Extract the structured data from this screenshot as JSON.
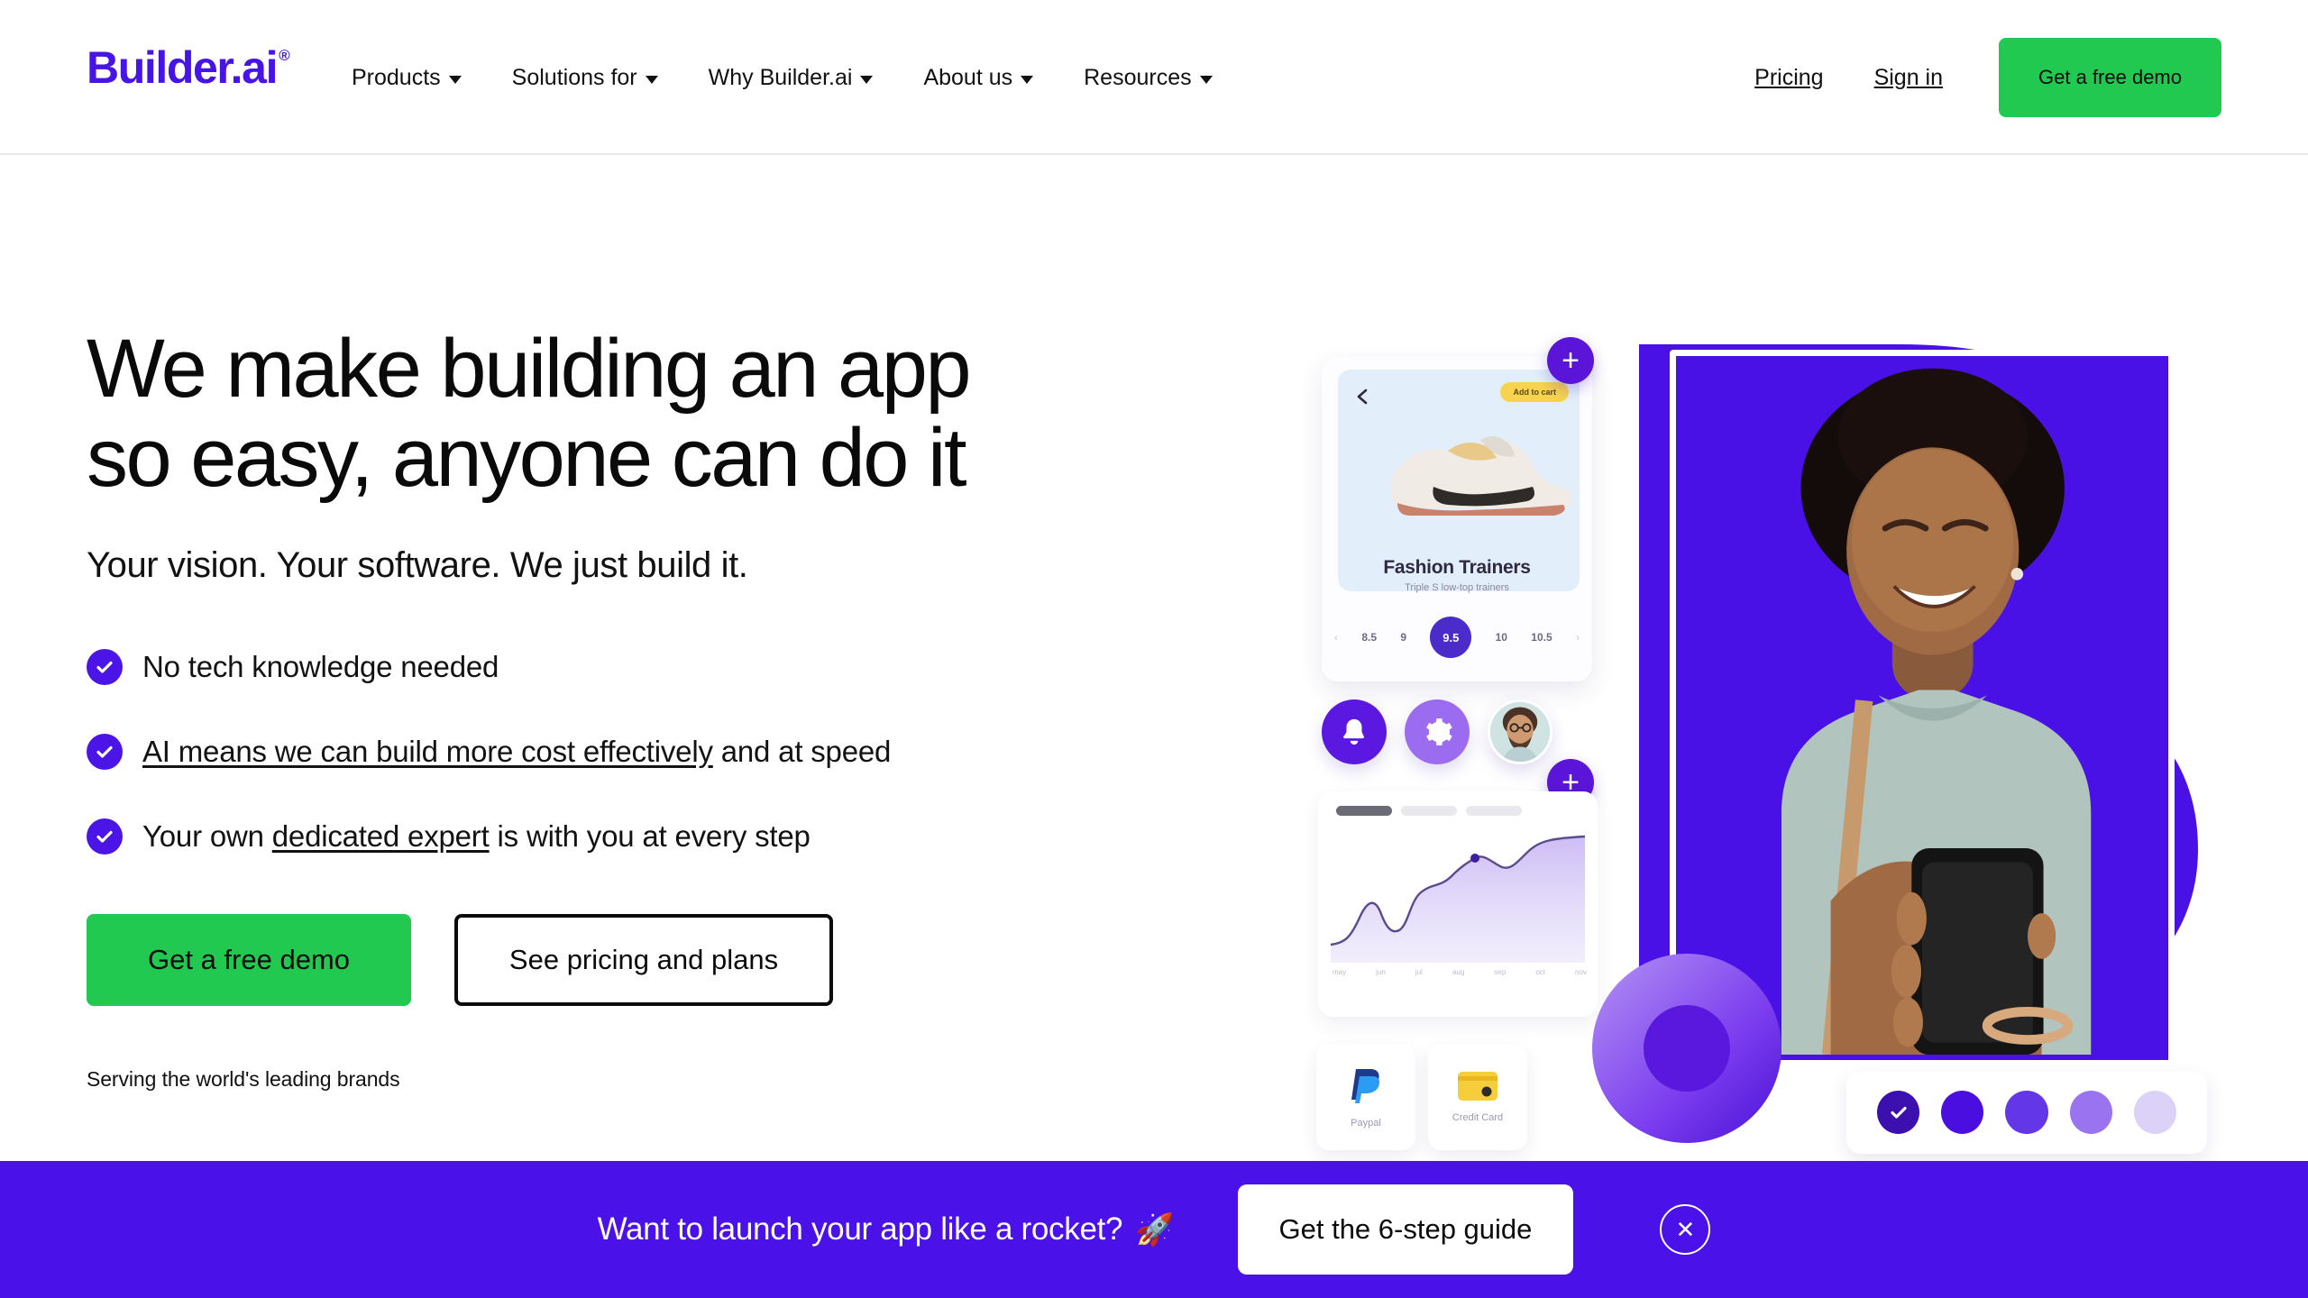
{
  "brand": {
    "logo_text": "Builder.ai",
    "logo_trademark": "®",
    "accent_purple": "#4614E6",
    "accent_green": "#22C950",
    "banner_purple": "#4A11E8"
  },
  "header": {
    "nav": [
      {
        "label": "Products",
        "has_caret": true
      },
      {
        "label": "Solutions for",
        "has_caret": true
      },
      {
        "label": "Why Builder.ai",
        "has_caret": true
      },
      {
        "label": "About us",
        "has_caret": true
      },
      {
        "label": "Resources",
        "has_caret": true
      }
    ],
    "pricing_label": "Pricing",
    "signin_label": "Sign in",
    "demo_label": "Get a free demo"
  },
  "hero": {
    "headline_line1": "We make building an app",
    "headline_line2": "so easy, anyone can do it",
    "subhead": "Your vision. Your software. We just build it.",
    "bullets": [
      {
        "pre": "",
        "link": "",
        "post": "No tech knowledge needed"
      },
      {
        "pre": "",
        "link": "AI means we can build more cost effectively",
        "post": " and at speed"
      },
      {
        "pre": "Your own ",
        "link": "dedicated expert",
        "post": " is with you at every step"
      }
    ],
    "cta_primary": "Get a free demo",
    "cta_secondary": "See pricing and plans",
    "serving": "Serving the world's leading brands"
  },
  "hero_art": {
    "product_card": {
      "badge": "Add to cart",
      "title": "Fashion Trainers",
      "subtitle": "Triple S low-top trainers",
      "sizes": [
        "‹",
        "8.5",
        "9",
        "9.5",
        "10",
        "10.5",
        "›"
      ],
      "selected_size": "9.5"
    },
    "icons": [
      "bell-icon",
      "gear-icon",
      "avatar"
    ],
    "chart": {
      "x_ticks": [
        "may",
        "jun",
        "jul",
        "aug",
        "sep",
        "oct",
        "nov"
      ]
    },
    "payments": [
      {
        "label": "Paypal",
        "icon": "paypal-icon"
      },
      {
        "label": "Credit Card",
        "icon": "credit-card-icon"
      }
    ],
    "swatches": [
      "#3C0FAF",
      "#4A0FE0",
      "#6337E8",
      "#9A74F0",
      "#DCD2F8"
    ],
    "selected_swatch_index": 0,
    "plus_badge": "+"
  },
  "banner": {
    "text": "Want to launch your app like a rocket?",
    "emoji": "🚀",
    "button": "Get the 6-step guide",
    "close": "✕"
  },
  "chart_data": {
    "type": "area",
    "title": "",
    "x": [
      "may",
      "jun",
      "jul",
      "aug",
      "sep",
      "oct",
      "nov"
    ],
    "values": [
      12,
      14,
      30,
      22,
      27,
      48,
      56,
      58,
      62,
      80
    ],
    "xlabel": "",
    "ylabel": "",
    "grid": false,
    "legend_position": "top-left"
  }
}
